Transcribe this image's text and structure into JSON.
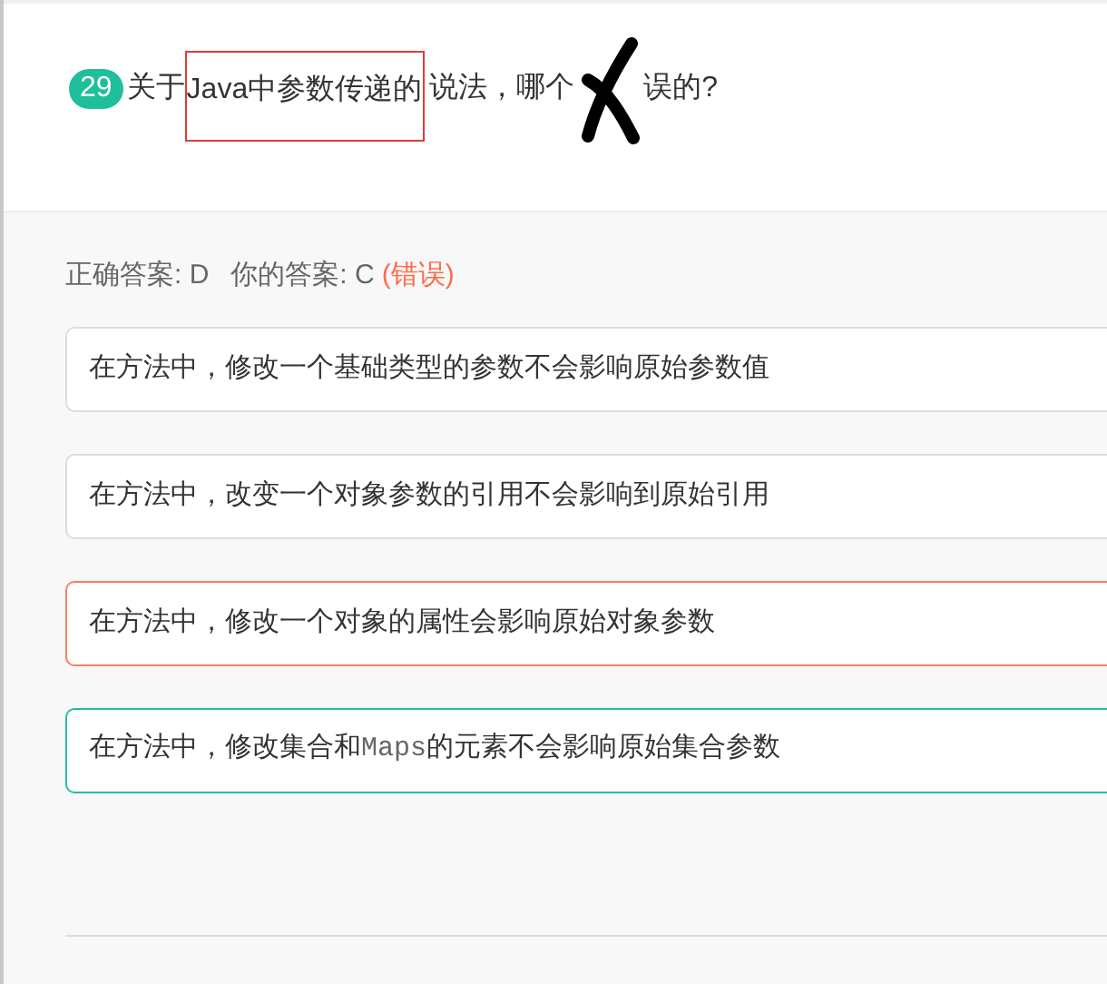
{
  "question": {
    "number": "29",
    "parts": [
      {
        "kind": "plain",
        "text": "关于"
      },
      {
        "kind": "boxed",
        "text": "Java中参数传递的"
      },
      {
        "kind": "plain",
        "text": "说法，哪个"
      },
      {
        "kind": "cross"
      },
      {
        "kind": "plain",
        "text": "误的?"
      }
    ]
  },
  "answer": {
    "correct_label": "正确答案: D",
    "yours_label": "你的答案: C",
    "verdict": "(错误)"
  },
  "options": [
    {
      "selected": false,
      "correct": false,
      "segments": [
        {
          "text": "在方法中，修改一个基础类型的参数不会影响原始参数值",
          "kind": "plain"
        }
      ]
    },
    {
      "selected": false,
      "correct": false,
      "segments": [
        {
          "text": "在方法中，改变一个对象参数的引用不会影响到原始引用",
          "kind": "plain"
        }
      ]
    },
    {
      "selected": true,
      "correct": false,
      "segments": [
        {
          "text": "在方法中，修改一个对象的属性会影响原始对象参数",
          "kind": "plain"
        }
      ]
    },
    {
      "selected": false,
      "correct": true,
      "segments": [
        {
          "text": "在方法中，修改集合和",
          "kind": "plain"
        },
        {
          "text": "Maps",
          "kind": "code"
        },
        {
          "text": "的元素不会影响原始集合参数",
          "kind": "plain"
        }
      ]
    }
  ]
}
